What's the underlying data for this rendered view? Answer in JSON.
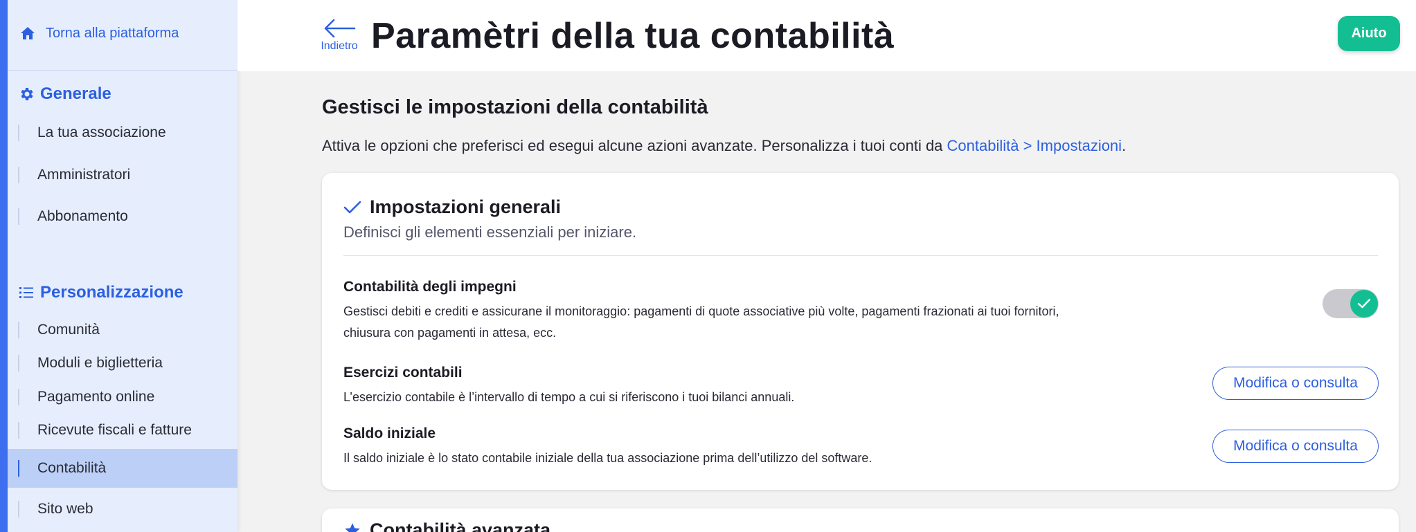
{
  "sidebar": {
    "back_link": "Torna alla piattaforma",
    "sections": [
      {
        "title": "Generale",
        "icon": "gear-icon"
      },
      {
        "title": "Personalizzazione",
        "icon": "list-icon"
      }
    ],
    "general_items": [
      "La tua associazione",
      "Amministratori",
      "Abbonamento"
    ],
    "custom_items": [
      "Comunità",
      "Moduli e biglietteria",
      "Pagamento online",
      "Ricevute fiscali e fatture",
      "Contabilità",
      "Sito web"
    ],
    "active_item": "Contabilità"
  },
  "header": {
    "back_label": "Indietro",
    "title": "Paramètri della tua contabilità",
    "help_label": "Aiuto"
  },
  "main": {
    "heading": "Gestisci le impostazioni della contabilità",
    "desc_prefix": "Attiva le opzioni che preferisci ed esegui alcune azioni avanzate. Personalizza i tuoi conti da ",
    "desc_link": "Contabilità > Impostazioni",
    "desc_suffix": "."
  },
  "card_general": {
    "title": "Impostazioni generali",
    "subtitle": "Definisci gli elementi essenziali per iniziare.",
    "settings": [
      {
        "title": "Contabilità degli impegni",
        "desc_line1": "Gestisci debiti e crediti e assicurane il monitoraggio: pagamenti di quote associative più volte, pagamenti frazionati ai tuoi fornitori,",
        "desc_line2": "chiusura con pagamenti in attesa, ecc.",
        "toggle_on": true
      },
      {
        "title": "Esercizi contabili",
        "desc": "L’esercizio contabile è l’intervallo di tempo a cui si riferiscono i tuoi bilanci annuali.",
        "button": "Modifica o consulta"
      },
      {
        "title": "Saldo iniziale",
        "desc": "Il saldo iniziale è lo stato contabile iniziale della tua associazione prima dell’utilizzo del software.",
        "button": "Modifica o consulta"
      }
    ]
  },
  "card_advanced": {
    "title": "Contabilità avanzata"
  },
  "colors": {
    "accent": "#2c5fe0",
    "success": "#13bf92",
    "sidebar_bg": "#e6eefd",
    "sidebar_active": "#bcd0f7"
  }
}
